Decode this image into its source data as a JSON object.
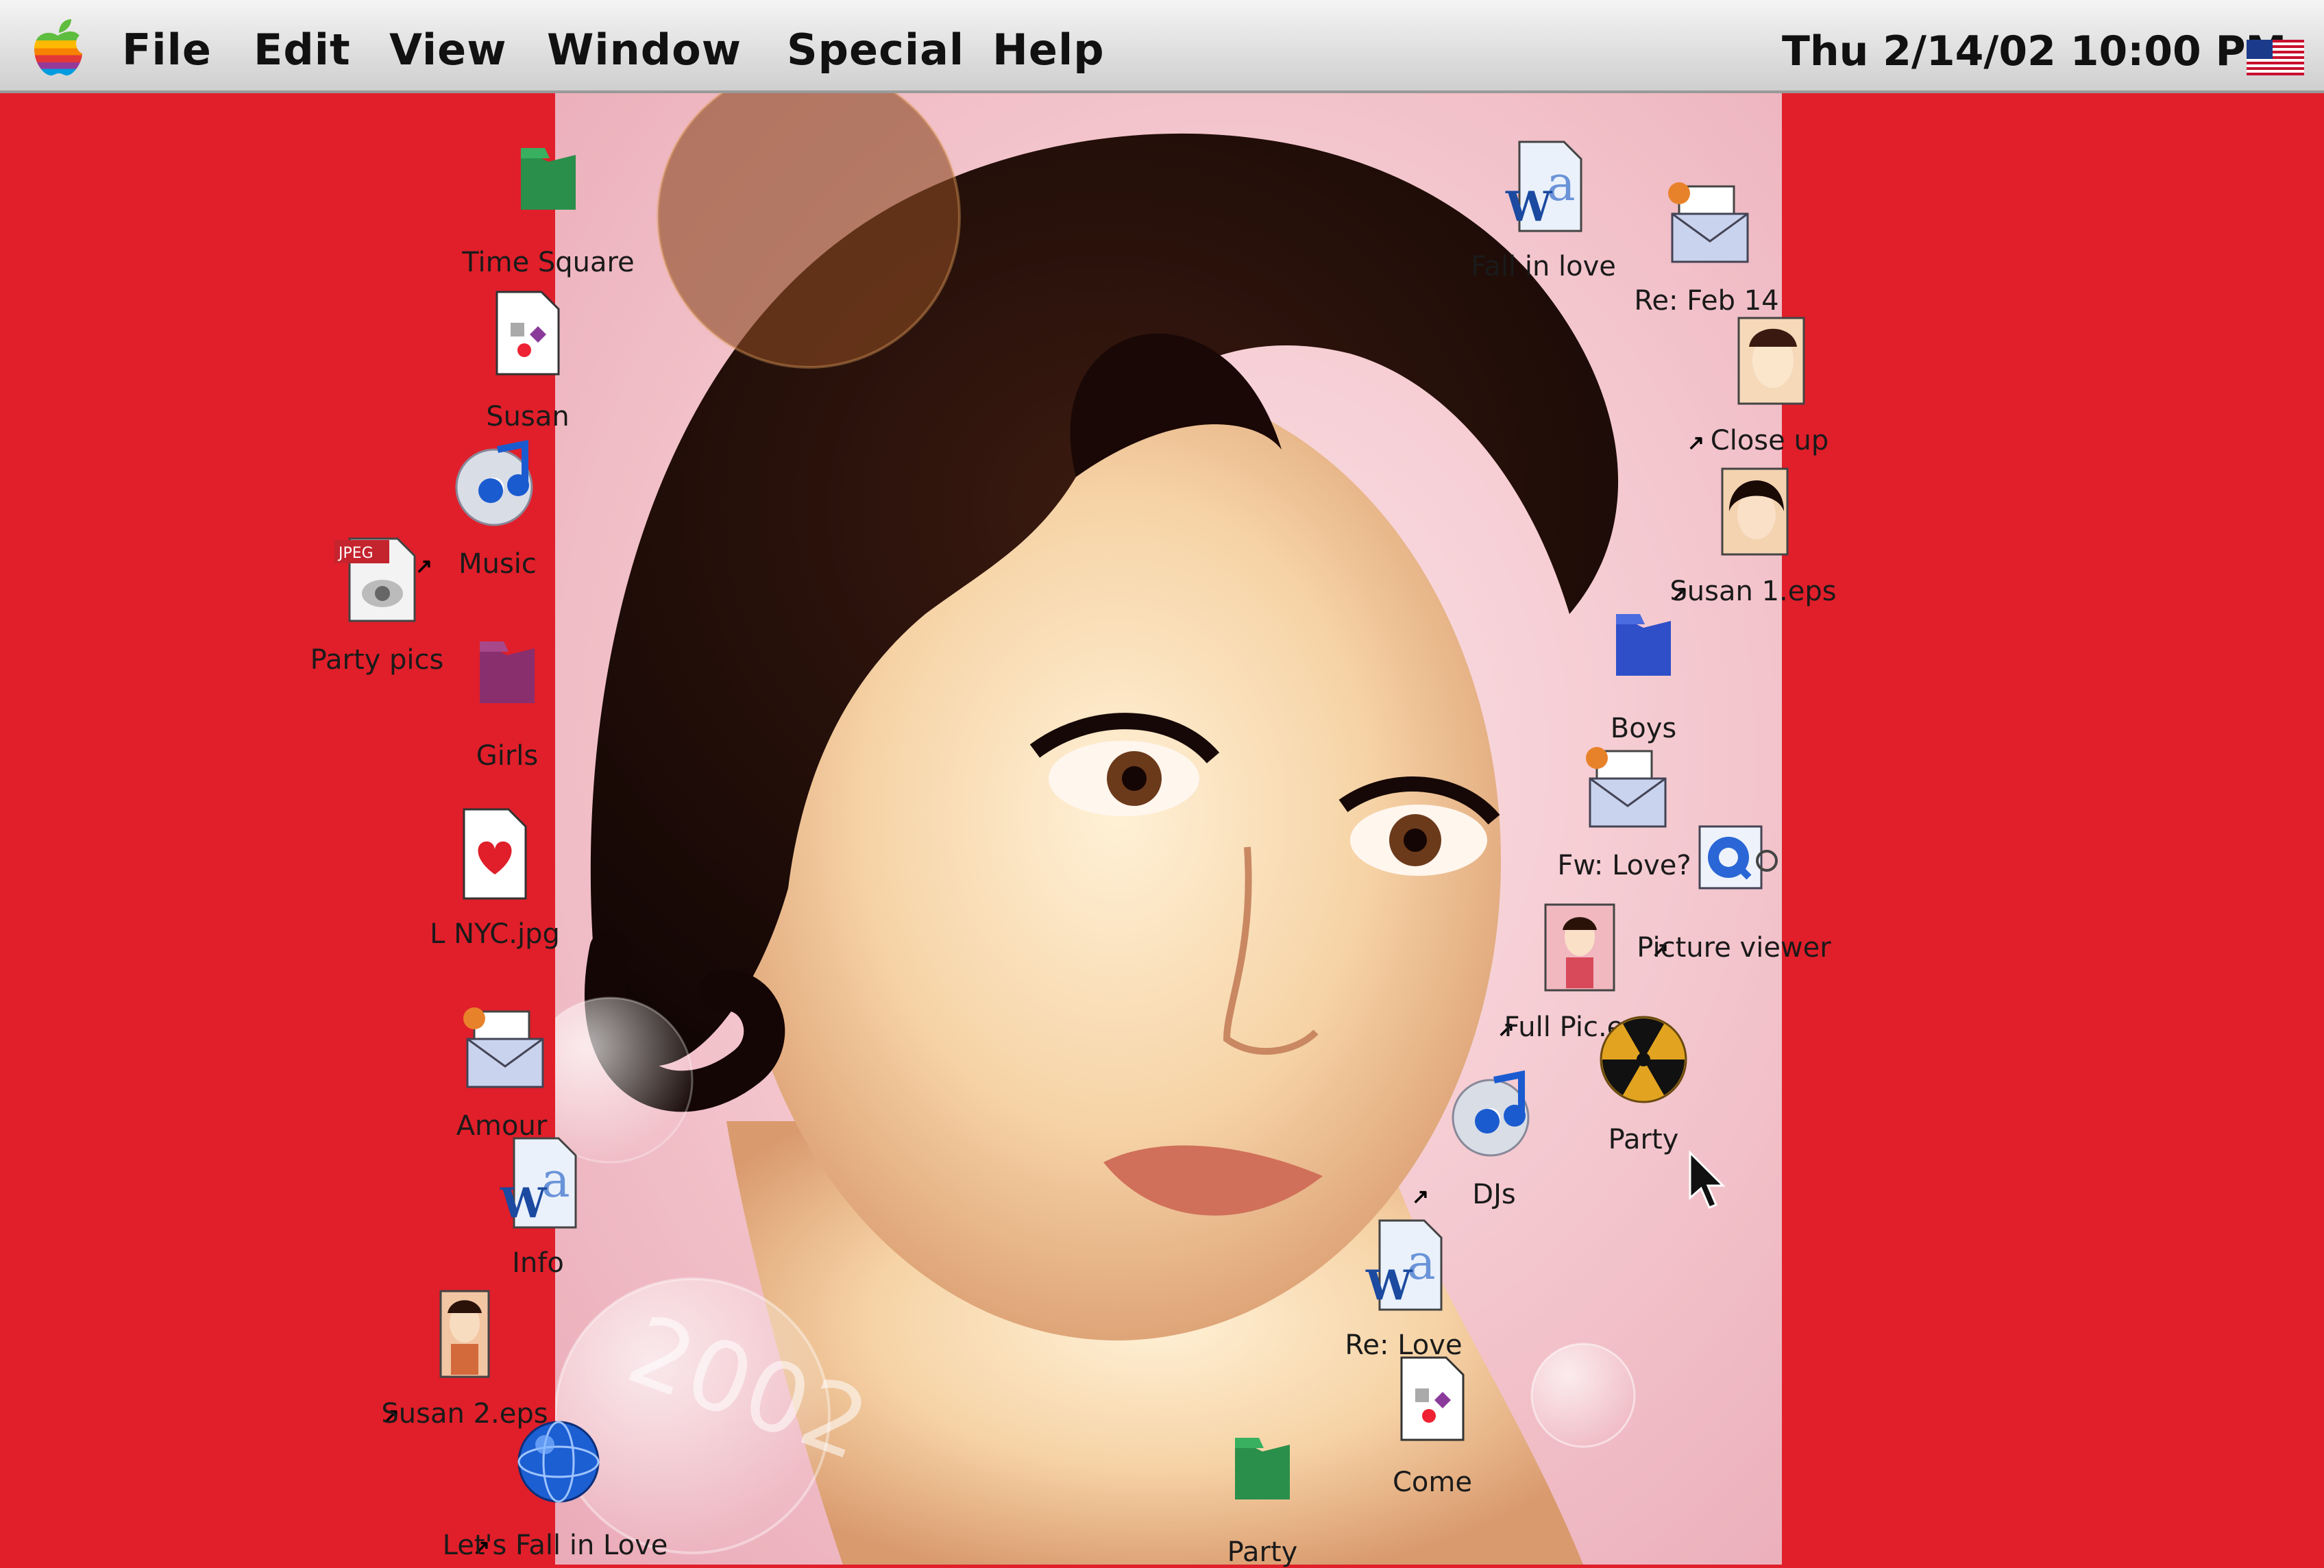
{
  "menubar": {
    "apple_menu_icon": "apple-icon",
    "items": [
      "File",
      "Edit",
      "View",
      "Window",
      "Special",
      "Help"
    ],
    "clock": "Thu 2/14/02 10:00 PM",
    "keyboard_icon": "us-flag-icon"
  },
  "desktop": {
    "background_color": "#e01f2a",
    "icons": {
      "time_square": "Time Square",
      "susan": "Susan",
      "music": "Music",
      "party_pics": "Party pics",
      "girls": "Girls",
      "l_nyc": "L NYC.jpg",
      "amour": "Amour",
      "info": "Info",
      "susan2": "Susan 2.eps",
      "lets_fall": "Let's Fall in Love",
      "fall_in_love": "Fall in love",
      "re_feb14": "Re: Feb 14",
      "close_up": "Close up",
      "susan1": "Susan 1.eps",
      "boys": "Boys",
      "fw_love": "Fw: Love?",
      "picture_viewer": "Picture viewer",
      "full_pic": "Full Pic.eps",
      "party_cd": "Party",
      "djs": "DJs",
      "re_love": "Re: Love",
      "come": "Come",
      "party_folder": "Party"
    },
    "wallpaper_text": "2002"
  }
}
